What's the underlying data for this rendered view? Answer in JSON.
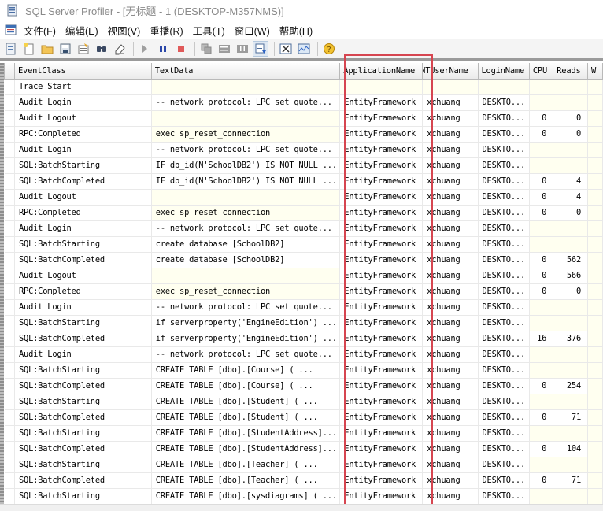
{
  "window": {
    "title": "SQL Server Profiler - [无标题 - 1 (DESKTOP-M357NMS)]",
    "app_icon": "profiler-icon"
  },
  "menubar": {
    "doc_icon": "trace-document-icon",
    "items": [
      "文件(F)",
      "编辑(E)",
      "视图(V)",
      "重播(R)",
      "工具(T)",
      "窗口(W)",
      "帮助(H)"
    ]
  },
  "toolbar": {
    "buttons": [
      {
        "icon": "trace-properties-icon"
      },
      {
        "icon": "new-trace-icon"
      },
      {
        "icon": "open-folder-icon"
      },
      {
        "icon": "save-icon"
      },
      {
        "icon": "properties-icon"
      },
      {
        "icon": "find-icon"
      },
      {
        "icon": "clear-trace-icon"
      },
      {
        "icon": "start-trace-icon"
      },
      {
        "icon": "pause-trace-icon"
      },
      {
        "icon": "stop-trace-icon"
      },
      {
        "icon": "copy-icon"
      },
      {
        "icon": "list-icon"
      },
      {
        "icon": "columns-icon"
      },
      {
        "icon": "auto-scroll-icon",
        "active": true
      },
      {
        "icon": "database-tuning-icon"
      },
      {
        "icon": "performance-monitor-icon"
      },
      {
        "icon": "help-icon"
      }
    ]
  },
  "colors": {
    "highlight_box": "#d64550",
    "na_cell_background": "#fffff0",
    "title_text": "#8a8a8a"
  },
  "grid": {
    "columns": [
      "EventClass",
      "TextData",
      "ApplicationName",
      "NTUserName",
      "LoginName",
      "CPU",
      "Reads",
      "W"
    ],
    "highlighted_column": "ApplicationName",
    "rows": [
      {
        "event": "Trace Start",
        "text": "",
        "app": "",
        "nt": "",
        "login": "",
        "cpu": "",
        "reads": "",
        "na_text": true,
        "na_app": true,
        "na_nt": true,
        "na_login": true,
        "na_cpu": true,
        "na_reads": true
      },
      {
        "event": "Audit Login",
        "text": "-- network protocol: LPC  set quote...",
        "app": "EntityFramework",
        "nt": "xchuang",
        "login": "DESKTO...",
        "cpu": "",
        "reads": "",
        "na_cpu": true,
        "na_reads": true
      },
      {
        "event": "Audit Logout",
        "text": "",
        "app": "EntityFramework",
        "nt": "xchuang",
        "login": "DESKTO...",
        "cpu": "0",
        "reads": "0",
        "na_text": true
      },
      {
        "event": "RPC:Completed",
        "text": "exec sp_reset_connection",
        "app": "EntityFramework",
        "nt": "xchuang",
        "login": "DESKTO...",
        "cpu": "0",
        "reads": "0",
        "na_text": true
      },
      {
        "event": "Audit Login",
        "text": "-- network protocol: LPC  set quote...",
        "app": "EntityFramework",
        "nt": "xchuang",
        "login": "DESKTO...",
        "cpu": "",
        "reads": "",
        "na_cpu": true,
        "na_reads": true
      },
      {
        "event": "SQL:BatchStarting",
        "text": "IF db_id(N'SchoolDB2') IS NOT NULL ...",
        "app": "EntityFramework",
        "nt": "xchuang",
        "login": "DESKTO...",
        "cpu": "",
        "reads": "",
        "na_cpu": true,
        "na_reads": true
      },
      {
        "event": "SQL:BatchCompleted",
        "text": "IF db_id(N'SchoolDB2') IS NOT NULL ...",
        "app": "EntityFramework",
        "nt": "xchuang",
        "login": "DESKTO...",
        "cpu": "0",
        "reads": "4"
      },
      {
        "event": "Audit Logout",
        "text": "",
        "app": "EntityFramework",
        "nt": "xchuang",
        "login": "DESKTO...",
        "cpu": "0",
        "reads": "4",
        "na_text": true
      },
      {
        "event": "RPC:Completed",
        "text": "exec sp_reset_connection",
        "app": "EntityFramework",
        "nt": "xchuang",
        "login": "DESKTO...",
        "cpu": "0",
        "reads": "0",
        "na_text": true
      },
      {
        "event": "Audit Login",
        "text": "-- network protocol: LPC  set quote...",
        "app": "EntityFramework",
        "nt": "xchuang",
        "login": "DESKTO...",
        "cpu": "",
        "reads": "",
        "na_cpu": true,
        "na_reads": true
      },
      {
        "event": "SQL:BatchStarting",
        "text": "create database [SchoolDB2]",
        "app": "EntityFramework",
        "nt": "xchuang",
        "login": "DESKTO...",
        "cpu": "",
        "reads": "",
        "na_cpu": true,
        "na_reads": true
      },
      {
        "event": "SQL:BatchCompleted",
        "text": "create database [SchoolDB2]",
        "app": "EntityFramework",
        "nt": "xchuang",
        "login": "DESKTO...",
        "cpu": "0",
        "reads": "562"
      },
      {
        "event": "Audit Logout",
        "text": "",
        "app": "EntityFramework",
        "nt": "xchuang",
        "login": "DESKTO...",
        "cpu": "0",
        "reads": "566",
        "na_text": true
      },
      {
        "event": "RPC:Completed",
        "text": "exec sp_reset_connection",
        "app": "EntityFramework",
        "nt": "xchuang",
        "login": "DESKTO...",
        "cpu": "0",
        "reads": "0",
        "na_text": true
      },
      {
        "event": "Audit Login",
        "text": "-- network protocol: LPC  set quote...",
        "app": "EntityFramework",
        "nt": "xchuang",
        "login": "DESKTO...",
        "cpu": "",
        "reads": "",
        "na_cpu": true,
        "na_reads": true
      },
      {
        "event": "SQL:BatchStarting",
        "text": "if serverproperty('EngineEdition') ...",
        "app": "EntityFramework",
        "nt": "xchuang",
        "login": "DESKTO...",
        "cpu": "",
        "reads": "",
        "na_cpu": true,
        "na_reads": true
      },
      {
        "event": "SQL:BatchCompleted",
        "text": "if serverproperty('EngineEdition') ...",
        "app": "EntityFramework",
        "nt": "xchuang",
        "login": "DESKTO...",
        "cpu": "16",
        "reads": "376"
      },
      {
        "event": "Audit Login",
        "text": "-- network protocol: LPC  set quote...",
        "app": "EntityFramework",
        "nt": "xchuang",
        "login": "DESKTO...",
        "cpu": "",
        "reads": "",
        "na_cpu": true,
        "na_reads": true
      },
      {
        "event": "SQL:BatchStarting",
        "text": "CREATE TABLE [dbo].[Course] (      ...",
        "app": "EntityFramework",
        "nt": "xchuang",
        "login": "DESKTO...",
        "cpu": "",
        "reads": "",
        "na_cpu": true,
        "na_reads": true
      },
      {
        "event": "SQL:BatchCompleted",
        "text": "CREATE TABLE [dbo].[Course] (      ...",
        "app": "EntityFramework",
        "nt": "xchuang",
        "login": "DESKTO...",
        "cpu": "0",
        "reads": "254"
      },
      {
        "event": "SQL:BatchStarting",
        "text": "CREATE TABLE [dbo].[Student] (     ...",
        "app": "EntityFramework",
        "nt": "xchuang",
        "login": "DESKTO...",
        "cpu": "",
        "reads": "",
        "na_cpu": true,
        "na_reads": true
      },
      {
        "event": "SQL:BatchCompleted",
        "text": "CREATE TABLE [dbo].[Student] (     ...",
        "app": "EntityFramework",
        "nt": "xchuang",
        "login": "DESKTO...",
        "cpu": "0",
        "reads": "71"
      },
      {
        "event": "SQL:BatchStarting",
        "text": "CREATE TABLE [dbo].[StudentAddress]...",
        "app": "EntityFramework",
        "nt": "xchuang",
        "login": "DESKTO...",
        "cpu": "",
        "reads": "",
        "na_cpu": true,
        "na_reads": true
      },
      {
        "event": "SQL:BatchCompleted",
        "text": "CREATE TABLE [dbo].[StudentAddress]...",
        "app": "EntityFramework",
        "nt": "xchuang",
        "login": "DESKTO...",
        "cpu": "0",
        "reads": "104"
      },
      {
        "event": "SQL:BatchStarting",
        "text": "CREATE TABLE [dbo].[Teacher] (     ...",
        "app": "EntityFramework",
        "nt": "xchuang",
        "login": "DESKTO...",
        "cpu": "",
        "reads": "",
        "na_cpu": true,
        "na_reads": true
      },
      {
        "event": "SQL:BatchCompleted",
        "text": "CREATE TABLE [dbo].[Teacher] (     ...",
        "app": "EntityFramework",
        "nt": "xchuang",
        "login": "DESKTO...",
        "cpu": "0",
        "reads": "71"
      },
      {
        "event": "SQL:BatchStarting",
        "text": "CREATE TABLE [dbo].[sysdiagrams] ( ...",
        "app": "EntityFramework",
        "nt": "xchuang",
        "login": "DESKTO...",
        "cpu": "",
        "reads": "",
        "na_cpu": true,
        "na_reads": true
      }
    ]
  }
}
